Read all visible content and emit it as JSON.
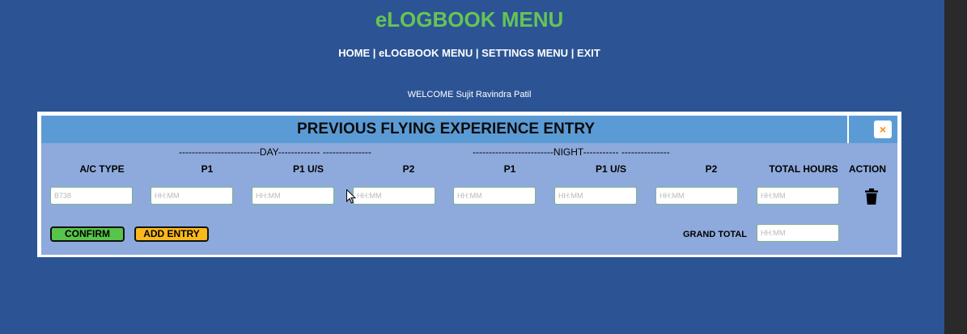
{
  "page": {
    "title": "eLOGBOOK MENU",
    "welcome": "WELCOME Sujit Ravindra Patil"
  },
  "nav": {
    "home": "HOME",
    "elogbook": "eLOGBOOK MENU",
    "settings": "SETTINGS MENU",
    "exit": "EXIT",
    "sep": " | "
  },
  "panel": {
    "title": "PREVIOUS FLYING EXPERIENCE ENTRY",
    "close_icon": "×",
    "day_label": "-------------------------DAY------------- ---------------",
    "night_label": "-------------------------NIGHT----------- ---------------",
    "columns": [
      "A/C TYPE",
      "P1",
      "P1 U/S",
      "P2",
      "P1",
      "P1 U/S",
      "P2",
      "TOTAL HOURS",
      "ACTION"
    ],
    "row": {
      "ac_type_placeholder": "B738",
      "time_placeholder": "HH:MM",
      "action_icon": "trash-icon"
    },
    "confirm_label": "CONFIRM",
    "add_entry_label": "ADD ENTRY",
    "grand_total_label": "GRAND TOTAL",
    "grand_total_placeholder": "HH:MM"
  },
  "colors": {
    "background": "#2c5494",
    "title_green": "#66c455",
    "panel_body": "#8eaadc",
    "panel_header": "#5b9bd5",
    "confirm": "#58c44a",
    "add_entry": "#fbb81c",
    "close_icon": "#f0901c"
  }
}
